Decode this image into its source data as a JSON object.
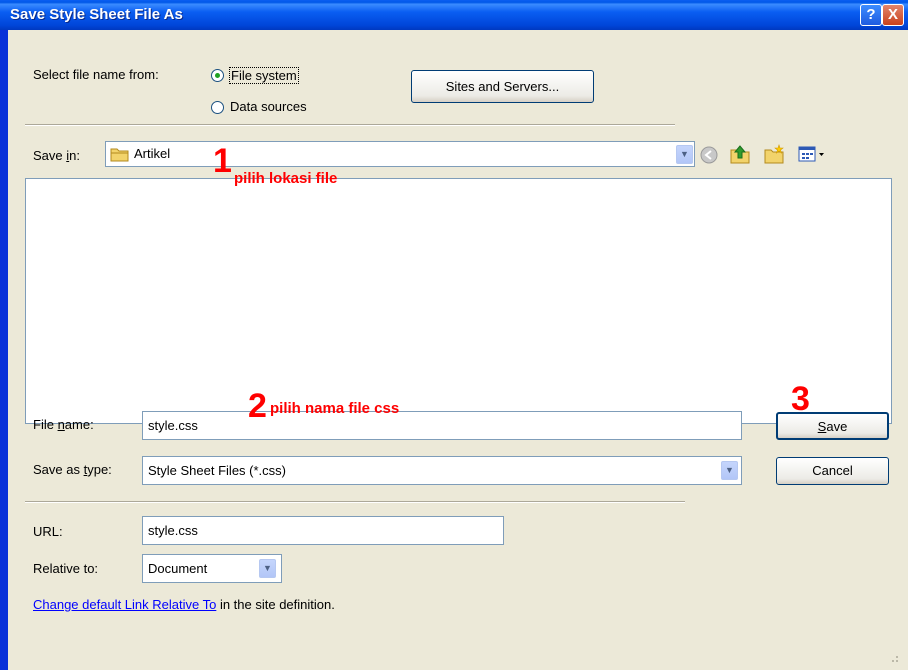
{
  "window": {
    "title": "Save Style Sheet File As",
    "help_label": "?",
    "close_label": "X"
  },
  "source": {
    "label": "Select file name from:",
    "options": [
      "File system",
      "Data sources"
    ],
    "selected": "File system",
    "sites_button": "Sites and Servers..."
  },
  "save_in": {
    "label_pre": "Save ",
    "label_key": "i",
    "label_post": "n:",
    "folder": "Artikel"
  },
  "file_name": {
    "label_pre": "File ",
    "label_key": "n",
    "label_post": "ame:",
    "value": "style.css"
  },
  "save_type": {
    "label_pre": "Save as ",
    "label_key": "t",
    "label_post": "ype:",
    "value": "Style Sheet Files (*.css)"
  },
  "buttons": {
    "save_key": "S",
    "save_rest": "ave",
    "cancel": "Cancel"
  },
  "url": {
    "label": "URL:",
    "value": "style.css"
  },
  "relative": {
    "label": "Relative to:",
    "value": "Document"
  },
  "change_link": {
    "link_text": "Change default Link Relative To",
    "rest_text": " in the site definition."
  },
  "annotations": {
    "n1": "1",
    "t1": "pilih lokasi file",
    "n2": "2",
    "t2": "pilih nama file css",
    "n3": "3"
  },
  "colors": {
    "annotation": "#ff0000",
    "titlebar": "#0a5ef2",
    "dialog_bg": "#ece9d8"
  },
  "icons": [
    "help-icon",
    "close-icon",
    "folder-icon",
    "back-icon",
    "up-folder-icon",
    "new-folder-icon",
    "view-menu-icon",
    "chevron-down-icon"
  ]
}
